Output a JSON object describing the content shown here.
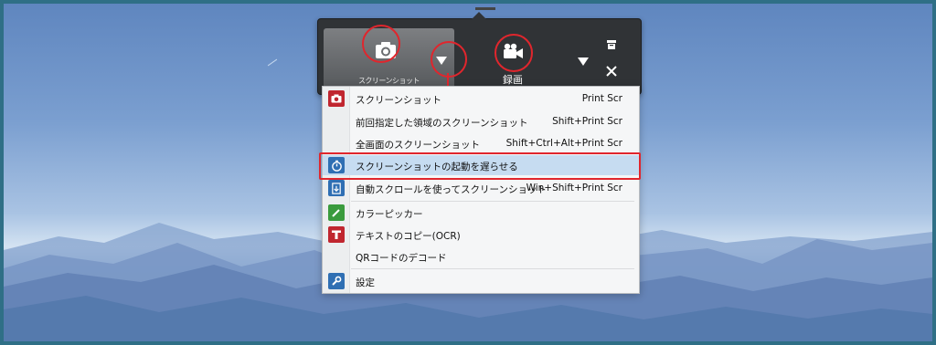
{
  "capture_toolbar": {
    "screenshot_label": "スクリーンショット",
    "record_label": "録画",
    "icons": {
      "screenshot": "camera-icon",
      "record": "video-camera-icon",
      "dropdown": "triangle-down-icon",
      "trash": "trash-icon",
      "close": "close-icon"
    }
  },
  "menu": {
    "items": [
      {
        "label": "スクリーンショット",
        "shortcut": "Print Scr",
        "icon": "camera-icon",
        "icon_color": "#c0262f"
      },
      {
        "label": "前回指定した領域のスクリーンショット",
        "shortcut": "Shift+Print Scr",
        "icon": ""
      },
      {
        "label": "全画面のスクリーンショット",
        "shortcut": "Shift+Ctrl+Alt+Print Scr",
        "icon": ""
      },
      {
        "label": "スクリーンショットの起動を遅らせる",
        "shortcut": "",
        "icon": "timer-icon",
        "icon_color": "#2f6fb3",
        "highlighted": true
      },
      {
        "label": "自動スクロールを使ってスクリーンショット",
        "shortcut": "Win+Shift+Print Scr",
        "icon": "scroll-capture-icon",
        "icon_color": "#2f6fb3"
      },
      {
        "label": "カラーピッカー",
        "shortcut": "",
        "icon": "pen-icon",
        "icon_color": "#3a9b3d"
      },
      {
        "label": "テキストのコピー(OCR)",
        "shortcut": "",
        "icon": "text-t-icon",
        "icon_color": "#c0262f"
      },
      {
        "label": "QRコードのデコード",
        "shortcut": "",
        "icon": ""
      },
      {
        "label": "設定",
        "shortcut": "",
        "icon": "wrench-icon",
        "icon_color": "#2f6fb3"
      }
    ]
  },
  "colors": {
    "annotation_red": "#e0262d",
    "toolbar_bg": "#303336",
    "menu_highlight": "#c6dcf1"
  }
}
